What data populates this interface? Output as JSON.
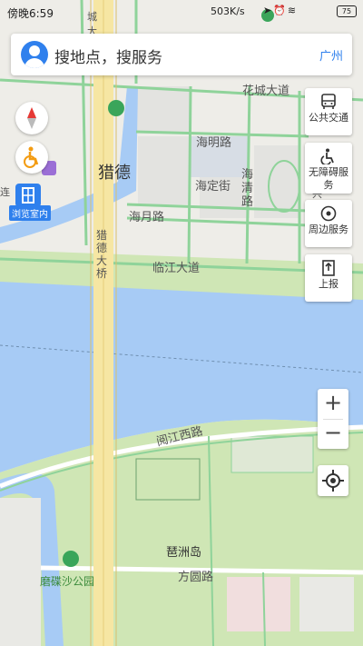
{
  "status_bar": {
    "time": "傍晚6:59",
    "speed": "503K/s",
    "battery": "75"
  },
  "search": {
    "placeholder": "搜地点，搜服务",
    "city": "广州"
  },
  "right_buttons": {
    "public_transport": "公共交通",
    "accessible_service": "无障碍服务",
    "nearby_service": "周边服务",
    "report": "上报"
  },
  "zoom": {
    "in": "+",
    "out": "−"
  },
  "indoor_label": "浏览室内",
  "map_labels": {
    "huacheng_ave": "花城大道",
    "haiming_rd": "海明路",
    "haiding_st": "海定街",
    "haiqing_rd": "海清路",
    "liede": "猎德",
    "haiyue_rd": "海月路",
    "linjiang_ave": "临江大道",
    "liede_bridge": "猎德大桥",
    "yuejiang_west": "阅江西路",
    "pazhou_island": "琶洲岛",
    "fangyuan_rd": "方圆路",
    "mozhesha_park": "磨碟沙公园",
    "frag_city": "城",
    "frag_da": "大",
    "frag_xing": "兴",
    "frag_lian": "连"
  },
  "colors": {
    "water": "#a7cbf5",
    "park": "#cfe6b5",
    "road_green": "#8fd39a",
    "highway": "#f6e6a3",
    "accent": "#2f80ed"
  },
  "icons": [
    "compass-icon",
    "wheelchair-icon",
    "hotel-icon",
    "building-icon",
    "bus-icon",
    "accessible-icon",
    "nearby-icon",
    "report-icon",
    "locate-icon",
    "park-poi-icon"
  ]
}
